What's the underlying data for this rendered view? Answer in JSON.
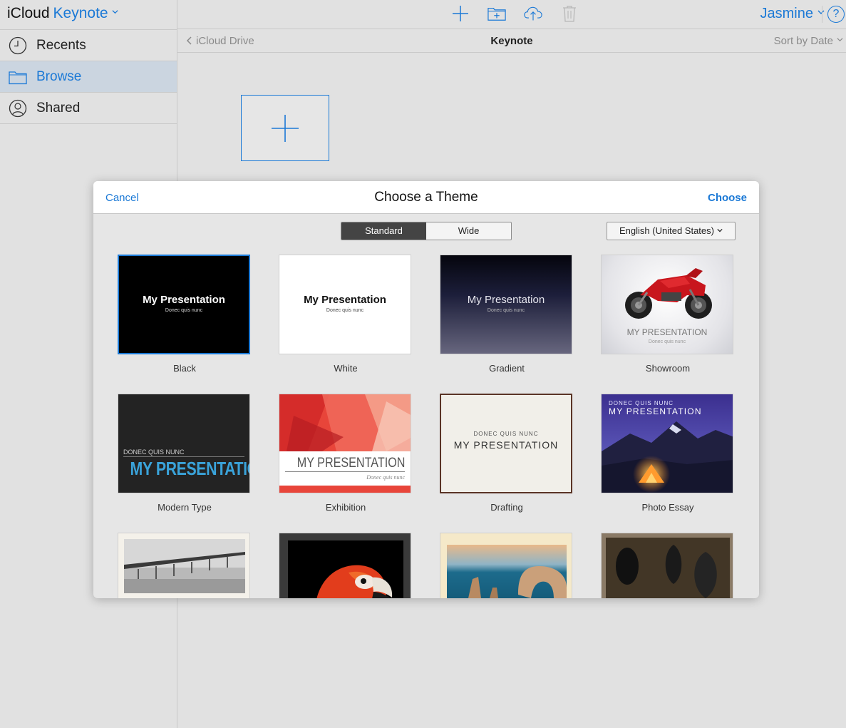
{
  "sidebar": {
    "brand_icloud": "iCloud",
    "brand_app": "Keynote",
    "items": [
      {
        "label": "Recents",
        "icon": "clock-icon"
      },
      {
        "label": "Browse",
        "icon": "folder-icon"
      },
      {
        "label": "Shared",
        "icon": "person-icon"
      }
    ]
  },
  "toolbar": {
    "user": "Jasmine",
    "help": "?"
  },
  "navbar": {
    "back_label": "iCloud Drive",
    "title": "Keynote",
    "sort_label": "Sort by Date"
  },
  "modal": {
    "title": "Choose a Theme",
    "cancel": "Cancel",
    "choose": "Choose",
    "segments": [
      "Standard",
      "Wide"
    ],
    "language": "English (United States)",
    "themes": [
      {
        "name": "Black",
        "title": "My Presentation",
        "subtitle": "Donec quis nunc"
      },
      {
        "name": "White",
        "title": "My Presentation",
        "subtitle": "Donec quis nunc"
      },
      {
        "name": "Gradient",
        "title": "My Presentation",
        "subtitle": "Donec quis nunc"
      },
      {
        "name": "Showroom",
        "title": "MY PRESENTATION",
        "subtitle": "Donec quis nunc"
      },
      {
        "name": "Modern Type",
        "title": "MY PRESENTATION",
        "subtitle": "DONEC QUIS NUNC"
      },
      {
        "name": "Exhibition",
        "title": "MY PRESENTATION",
        "subtitle": "Donec quis nunc"
      },
      {
        "name": "Drafting",
        "title": "MY PRESENTATION",
        "subtitle": "DONEC QUIS NUNC"
      },
      {
        "name": "Photo Essay",
        "title": "MY PRESENTATION",
        "subtitle": "DONEC QUIS NUNC"
      }
    ]
  },
  "colors": {
    "accent": "#1b79d6",
    "background": "#e1e1e1",
    "selected_row": "#cbd5e0"
  }
}
